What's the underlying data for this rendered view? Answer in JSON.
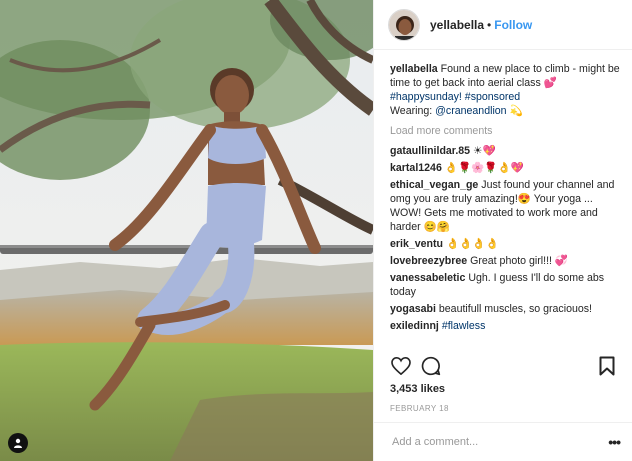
{
  "header": {
    "username": "yellabella",
    "separator": "•",
    "follow_label": "Follow"
  },
  "caption": {
    "username": "yellabella",
    "text_1": "Found a new place to climb - might be time to get back into aerial class",
    "emoji_1": "💕",
    "tags": "#happysunday! #sponsored",
    "wearing_label": "Wearing:",
    "wearing_handle": "@craneandlion",
    "emoji_2": "💫"
  },
  "load_more": "Load more comments",
  "comments": [
    {
      "user": "gataullinildar.85",
      "text": "☀💖"
    },
    {
      "user": "kartal1246",
      "text": "👌🌹🌸🌹👌💖"
    },
    {
      "user": "ethical_vegan_ge",
      "text": "Just found your channel and omg you are truly amazing!😍 Your yoga ... WOW! Gets me motivated to work more and harder 😊🤗"
    },
    {
      "user": "erik_ventu",
      "text": "👌👌👌👌"
    },
    {
      "user": "lovebreezybree",
      "text": "Great photo girl!!! 💞"
    },
    {
      "user": "vanessabeletic",
      "text": "Ugh. I guess I'll do some abs today"
    },
    {
      "user": "yogasabi",
      "text": "beautifull muscles, so graciouos!"
    },
    {
      "user": "exiledinnj",
      "text": "#flawless"
    }
  ],
  "likes": "3,453 likes",
  "date": "FEBRUARY 18",
  "add_comment": {
    "placeholder": "Add a comment..."
  },
  "more_options": "•••",
  "icons": {
    "heart": "heart-icon",
    "comment": "comment-icon",
    "bookmark": "bookmark-icon",
    "tagged_user": "user-tag-icon"
  }
}
